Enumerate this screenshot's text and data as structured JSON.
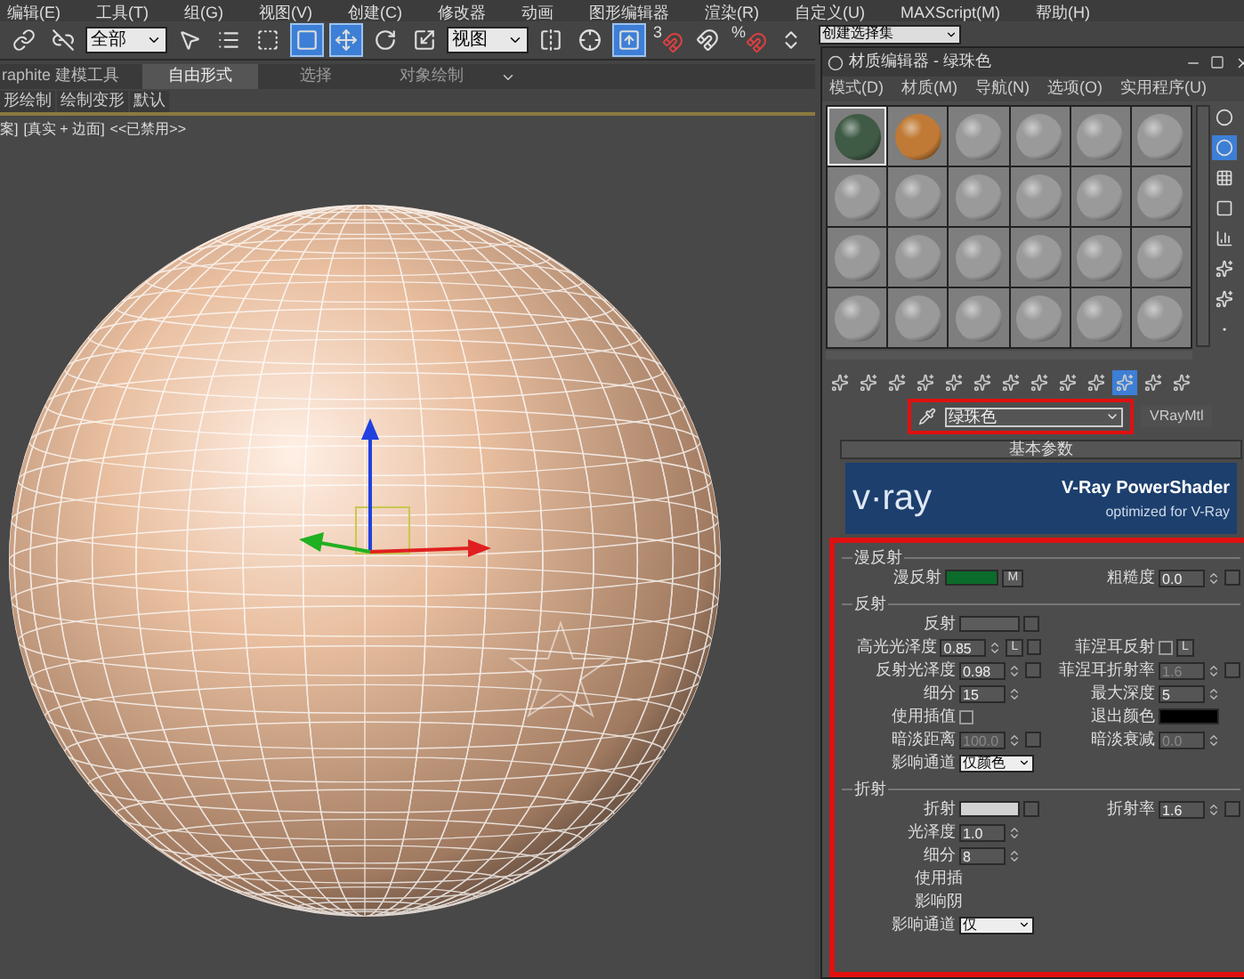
{
  "menu": [
    "编辑(E)",
    "工具(T)",
    "组(G)",
    "视图(V)",
    "创建(C)",
    "修改器",
    "动画",
    "图形编辑器",
    "渲染(R)",
    "自定义(U)",
    "MAXScript(M)",
    "帮助(H)"
  ],
  "toolbar": {
    "items": [
      {
        "kind": "icon",
        "selected": false
      },
      {
        "kind": "icon",
        "selected": false
      },
      {
        "kind": "dropdown",
        "value": "全部"
      },
      {
        "kind": "icon",
        "selected": false
      },
      {
        "kind": "icon",
        "selected": false
      },
      {
        "kind": "icon",
        "selected": false
      },
      {
        "kind": "icon",
        "selected": true
      },
      {
        "kind": "icon",
        "selected": true
      },
      {
        "kind": "icon",
        "selected": false
      },
      {
        "kind": "icon",
        "selected": false
      },
      {
        "kind": "dropdown",
        "value": "视图"
      },
      {
        "kind": "icon",
        "selected": false
      },
      {
        "kind": "icon",
        "selected": false
      },
      {
        "kind": "icon",
        "selected": true
      },
      {
        "kind": "snap",
        "label": "3"
      },
      {
        "kind": "icon",
        "selected": false
      },
      {
        "kind": "snap",
        "label": "%"
      },
      {
        "kind": "icon",
        "selected": false
      }
    ],
    "selection_set": "创建选择集"
  },
  "ribbon": {
    "title": "raphite 建模工具",
    "tabs": [
      {
        "label": "自由形式",
        "selected": true
      },
      {
        "label": "选择",
        "selected": false
      },
      {
        "label": "对象绘制",
        "selected": false
      }
    ],
    "panels": [
      "形绘制",
      "绘制变形",
      "默认"
    ]
  },
  "viewport": {
    "label_cut": "案]",
    "shading": "[真实 + 边面]",
    "status": "<<已禁用>>"
  },
  "editor": {
    "title": "材质编辑器 - 绿珠色",
    "menu": [
      "模式(D)",
      "材质(M)",
      "导航(N)",
      "选项(O)",
      "实用程序(U)"
    ],
    "side_tools": [
      {
        "selected": false
      },
      {
        "selected": true
      },
      {
        "selected": false
      },
      {
        "selected": false
      },
      {
        "selected": false
      },
      {
        "selected": false
      },
      {
        "selected": false
      },
      {
        "selected": false
      }
    ],
    "samples": [
      {
        "color": "#3f5a45",
        "selected": true
      },
      {
        "color": "#c07a35",
        "selected": false
      },
      {
        "color": "#9a9a9a",
        "selected": false
      },
      {
        "color": "#9a9a9a",
        "selected": false
      },
      {
        "color": "#9a9a9a",
        "selected": false
      },
      {
        "color": "#9a9a9a",
        "selected": false
      },
      {
        "color": "#9a9a9a",
        "selected": false
      },
      {
        "color": "#9a9a9a",
        "selected": false
      },
      {
        "color": "#9a9a9a",
        "selected": false
      },
      {
        "color": "#9a9a9a",
        "selected": false
      },
      {
        "color": "#9a9a9a",
        "selected": false
      },
      {
        "color": "#9a9a9a",
        "selected": false
      },
      {
        "color": "#9a9a9a",
        "selected": false
      },
      {
        "color": "#9a9a9a",
        "selected": false
      },
      {
        "color": "#9a9a9a",
        "selected": false
      },
      {
        "color": "#9a9a9a",
        "selected": false
      },
      {
        "color": "#9a9a9a",
        "selected": false
      },
      {
        "color": "#9a9a9a",
        "selected": false
      },
      {
        "color": "#9a9a9a",
        "selected": false
      },
      {
        "color": "#9a9a9a",
        "selected": false
      },
      {
        "color": "#9a9a9a",
        "selected": false
      },
      {
        "color": "#9a9a9a",
        "selected": false
      },
      {
        "color": "#9a9a9a",
        "selected": false
      },
      {
        "color": "#9a9a9a",
        "selected": false
      }
    ],
    "tools": [
      {
        "selected": false
      },
      {
        "selected": false
      },
      {
        "selected": false
      },
      {
        "selected": false
      },
      {
        "selected": false
      },
      {
        "selected": false
      },
      {
        "selected": false
      },
      {
        "selected": false
      },
      {
        "selected": false
      },
      {
        "selected": false
      },
      {
        "selected": true
      },
      {
        "selected": false
      },
      {
        "selected": false
      }
    ],
    "material_name": "绿珠色",
    "material_type": "VRayMtl",
    "rollout": "基本参数",
    "banner": {
      "logo": "v·ray",
      "title": "V-Ray PowerShader",
      "subtitle": "optimized for V-Ray"
    },
    "sections": [
      {
        "title": "漫反射",
        "rows": [
          [
            {
              "kind": "swatch",
              "label": "漫反射",
              "color": "#0b6b2b",
              "button": "M",
              "map_slot": false
            },
            {
              "kind": "spinner",
              "label": "粗糙度",
              "value": "0.0",
              "disabled": false,
              "map_slot": true
            }
          ]
        ]
      },
      {
        "title": "反射",
        "rows": [
          [
            {
              "kind": "swatch",
              "label": "反射",
              "color": "#5c5c5c",
              "map_slot": true
            },
            null
          ],
          [
            {
              "kind": "spinner",
              "label": "高光光泽度",
              "value": "0.85",
              "disabled": false,
              "button": "L",
              "map_slot": true
            },
            {
              "kind": "check",
              "label": "菲涅耳反射",
              "checked": false,
              "button": "L",
              "map_slot": false
            }
          ],
          [
            {
              "kind": "spinner",
              "label": "反射光泽度",
              "value": "0.98",
              "disabled": false,
              "map_slot": true
            },
            {
              "kind": "spinner",
              "label": "菲涅耳折射率",
              "value": "1.6",
              "disabled": true,
              "map_slot": true
            }
          ],
          [
            {
              "kind": "spinner",
              "label": "细分",
              "value": "15",
              "disabled": false,
              "map_slot": false
            },
            {
              "kind": "spinner",
              "label": "最大深度",
              "value": "5",
              "disabled": false,
              "map_slot": false
            }
          ],
          [
            {
              "kind": "check",
              "label": "使用插值",
              "checked": false,
              "map_slot": false
            },
            {
              "kind": "swatch",
              "label": "退出颜色",
              "color": "#000000",
              "map_slot": false
            }
          ],
          [
            {
              "kind": "spinner",
              "label": "暗淡距离",
              "value": "100.0",
              "disabled": true,
              "map_slot": true
            },
            {
              "kind": "spinner",
              "label": "暗淡衰减",
              "value": "0.0",
              "disabled": true,
              "map_slot": false
            }
          ],
          [
            {
              "kind": "dropdown",
              "label": "影响通道",
              "value": "仅颜色"
            },
            null
          ]
        ]
      },
      {
        "title": "折射",
        "rows": [
          [
            {
              "kind": "swatch",
              "label": "折射",
              "color": "#d2d2d2",
              "map_slot": true
            },
            {
              "kind": "spinner",
              "label": "折射率",
              "value": "1.6",
              "disabled": false,
              "map_slot": true
            }
          ],
          [
            {
              "kind": "spinner",
              "label": "光泽度",
              "value": "1.0",
              "disabled": false,
              "map_slot": false
            },
            null
          ],
          [
            {
              "kind": "spinner",
              "label": "细分",
              "value": "8",
              "disabled": false,
              "map_slot": false
            },
            null
          ],
          [
            {
              "kind": "text",
              "label": "使用插"
            },
            null
          ],
          [
            {
              "kind": "text",
              "label": "影响阴"
            },
            null
          ],
          [
            {
              "kind": "dropdown",
              "label": "影响通道",
              "value": "仅"
            },
            null
          ]
        ]
      }
    ]
  }
}
